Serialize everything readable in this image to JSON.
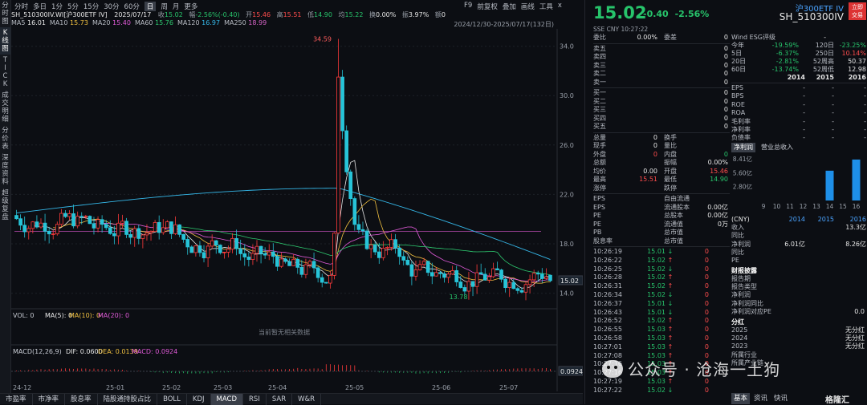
{
  "left_tabs": [
    "分时\n图",
    "K\n线\n图",
    "T\nI\nC\nK",
    "成交\n明细",
    "分价\n表",
    "深度\n资料",
    "超级\n复盘"
  ],
  "toolbar": {
    "items": [
      "分时",
      "多日",
      "1分",
      "5分",
      "15分",
      "30分",
      "60分",
      "日",
      "周",
      "月",
      "更多"
    ],
    "active": "日",
    "right": [
      "F9",
      "前复权",
      "叠加",
      "画线",
      "工具"
    ],
    "close_icon": "x"
  },
  "info": {
    "code": "SH_510300IV.WI[沪300ETF IV]",
    "date": "2025/07/17",
    "close_label": "收",
    "close": "15.02",
    "chg_label": "幅",
    "chg": "-2.56%(-0.40)",
    "open_label": "开",
    "open": "15.46",
    "high_label": "高",
    "high": "15.51",
    "low_label": "低",
    "low": "14.90",
    "avg_label": "均",
    "avg": "15.22",
    "turn_label": "换",
    "turn": "0.00%",
    "amp_label": "振",
    "amp": "3.97%",
    "amt_label": "额",
    "amt": "0"
  },
  "ma": [
    {
      "label": "MA5",
      "value": "16.01",
      "color": "#e8e8e8"
    },
    {
      "label": "MA10",
      "value": "15.73",
      "color": "#f0c040"
    },
    {
      "label": "MA20",
      "value": "15.40",
      "color": "#e05ad8"
    },
    {
      "label": "MA60",
      "value": "15.76",
      "color": "#2ecc71"
    },
    {
      "label": "MA120",
      "value": "16.97",
      "color": "#35b7e8"
    },
    {
      "label": "MA250",
      "value": "18.99",
      "color": "#d864c8"
    }
  ],
  "range": "2024/12/30-2025/07/17(132日)",
  "chart_data": {
    "type": "candlestick",
    "y_ticks": [
      14.0,
      18.0,
      22.0,
      26.0,
      30.0,
      34.0
    ],
    "ylim": [
      13.2,
      35.4
    ],
    "x_labels": [
      "24-12",
      "25-01",
      "25-02",
      "25-03",
      "25-04",
      "25-05",
      "25-06",
      "25-07"
    ],
    "max_label": "34.59",
    "min_label": "13.78",
    "last_label": "15.02",
    "reference_line": 19.0
  },
  "vol": {
    "label": "VOL: 0",
    "ma5": "MA(5): 0",
    "ma10": "MA(10): 0",
    "ma20": "MA(20): 0",
    "empty": "当前暂无相关数据"
  },
  "macd": {
    "label": "MACD(12,26,9)",
    "dif": "DIF: 0.0600",
    "dea": "DEA: 0.0139",
    "macd": "MACD: 0.0924",
    "last": "0.0924"
  },
  "bottom_tabs": [
    "市盈率",
    "市净率",
    "股息率",
    "陆股通持股占比",
    "BOLL",
    "KDJ",
    "MACD",
    "RSI",
    "SAR",
    "W&R"
  ],
  "bottom_active": "MACD",
  "quote": {
    "price": "15.02",
    "chg": "-0.40",
    "pct": "-2.56%",
    "name": "沪300ETF IV",
    "code": "SH_510300IV",
    "badge": "立即\n交易",
    "meta": "SSE  CNY   10:27:22"
  },
  "book": {
    "wb": [
      "委比",
      "0.00%",
      "委差",
      "0"
    ],
    "asks": [
      [
        "卖五",
        "0"
      ],
      [
        "卖四",
        "0"
      ],
      [
        "卖三",
        "0"
      ],
      [
        "卖二",
        "0"
      ],
      [
        "卖一",
        "0"
      ]
    ],
    "bids": [
      [
        "买一",
        "0"
      ],
      [
        "买二",
        "0"
      ],
      [
        "买三",
        "0"
      ],
      [
        "买四",
        "0"
      ],
      [
        "买五",
        "0"
      ]
    ]
  },
  "stats": [
    [
      "总量",
      "0",
      "换手",
      ""
    ],
    [
      "现手",
      "0",
      "量比",
      ""
    ],
    [
      "外盘",
      "0",
      "内盘",
      "0"
    ],
    [
      "总额",
      "",
      "振幅",
      "0.00%"
    ],
    [
      "均价",
      "0.00",
      "开盘",
      "15.46"
    ],
    [
      "最高",
      "15.51",
      "最低",
      "14.90"
    ],
    [
      "涨停",
      "",
      "跌停",
      ""
    ]
  ],
  "eps": [
    [
      "EPS",
      "",
      "自由流通",
      ""
    ],
    [
      "EPS",
      "",
      "流通股本",
      "0.00亿"
    ],
    [
      "PE",
      "",
      "总股本",
      "0.00亿"
    ],
    [
      "PE",
      "",
      "流通值",
      "0万"
    ],
    [
      "PB",
      "",
      "总市值",
      ""
    ],
    [
      "股息率",
      "",
      "总市值",
      ""
    ]
  ],
  "ticks": [
    [
      "10:26:19",
      "15.01",
      "↓",
      "0"
    ],
    [
      "10:26:22",
      "15.02",
      "↑",
      "0"
    ],
    [
      "10:26:25",
      "15.02",
      "↓",
      "0"
    ],
    [
      "10:26:28",
      "15.02",
      "↑",
      "0"
    ],
    [
      "10:26:31",
      "15.02",
      "↑",
      "0"
    ],
    [
      "10:26:34",
      "15.02",
      "↓",
      "0"
    ],
    [
      "10:26:37",
      "15.01",
      "↓",
      "0"
    ],
    [
      "10:26:43",
      "15.01",
      "↓",
      "0"
    ],
    [
      "10:26:52",
      "15.02",
      "↑",
      "0"
    ],
    [
      "10:26:55",
      "15.03",
      "↑",
      "0"
    ],
    [
      "10:26:58",
      "15.03",
      "↑",
      "0"
    ],
    [
      "10:27:01",
      "15.03",
      "↑",
      "0"
    ],
    [
      "10:27:08",
      "15.03",
      "↑",
      "0"
    ],
    [
      "10:27:16",
      "15.03",
      "↑",
      "0"
    ],
    [
      "10:27:16",
      "15.03",
      "↑",
      "0"
    ],
    [
      "10:27:19",
      "15.03",
      "↑",
      "0"
    ],
    [
      "10:27:22",
      "15.02",
      "↓",
      "0"
    ]
  ],
  "esg": {
    "label": "Wind ESG评级",
    "val": "-"
  },
  "perf": [
    [
      "今年",
      "-19.59%",
      "120日",
      "-23.25%"
    ],
    [
      "5日",
      "-6.37%",
      "250日",
      "10.14%"
    ],
    [
      "20日",
      "-2.81%",
      "52周高",
      "50.37"
    ],
    [
      "60日",
      "-13.74%",
      "52周低",
      "12.98"
    ]
  ],
  "fin_head": [
    "",
    "2014",
    "2015",
    "2016"
  ],
  "fin": [
    [
      "EPS",
      "-",
      "-",
      "-"
    ],
    [
      "BPS",
      "-",
      "-",
      "-"
    ],
    [
      "ROE",
      "-",
      "-",
      "-"
    ],
    [
      "ROA",
      "-",
      "-",
      "-"
    ],
    [
      "毛利率",
      "-",
      "-",
      "-"
    ],
    [
      "净利率",
      "-",
      "-",
      "-"
    ],
    [
      "负债率",
      "-",
      "-",
      "-"
    ]
  ],
  "fin_tabs": [
    "净利润",
    "营业总收入"
  ],
  "bar": {
    "yt": [
      "8.41亿",
      "5.60亿",
      "2.80亿"
    ],
    "xt": [
      "9",
      "10",
      "11",
      "12",
      "13",
      "14",
      "15",
      "16"
    ],
    "vals": [
      0,
      0,
      0,
      0,
      0,
      6.01,
      0,
      8.26
    ],
    "years": [
      "(CNY)",
      "2014",
      "2015",
      "2016"
    ]
  },
  "income": [
    [
      "收入",
      "",
      "",
      "13.3亿"
    ],
    [
      "同比",
      "",
      "",
      ""
    ],
    [
      "净利润",
      "6.01亿",
      "",
      "8.26亿"
    ],
    [
      "同比",
      "",
      "",
      ""
    ],
    [
      "PE",
      "",
      "",
      ""
    ]
  ],
  "report": {
    "title": "财报披露",
    "rows": [
      [
        "报告期",
        ""
      ],
      [
        "报告类型",
        ""
      ],
      [
        "净利润",
        ""
      ],
      [
        "净利润同比",
        ""
      ],
      [
        "净利润对应PE",
        "0.0"
      ]
    ]
  },
  "div": {
    "title": "分红",
    "rows": [
      [
        "2025",
        "无分红"
      ],
      [
        "2024",
        "无分红"
      ],
      [
        "2023",
        "无分红"
      ]
    ]
  },
  "extra": {
    "a": "所属行业",
    "b": "所属产业链",
    "c": "主营业务"
  },
  "right_bottom": [
    "基本",
    "资讯",
    "快讯"
  ],
  "watermark": "公众号 · 沧海一土狗",
  "logo": "格隆汇"
}
